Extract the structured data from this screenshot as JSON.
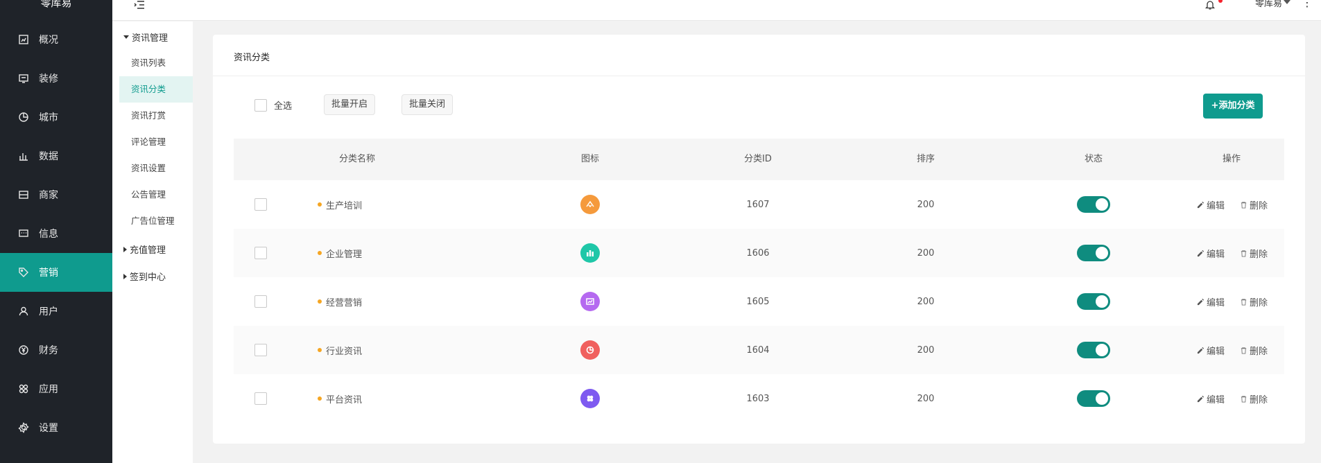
{
  "app": {
    "brand": "零库易"
  },
  "sidebar": {
    "items": [
      {
        "label": "概况",
        "icon": "overview-icon"
      },
      {
        "label": "装修",
        "icon": "decoration-icon"
      },
      {
        "label": "城市",
        "icon": "city-icon"
      },
      {
        "label": "数据",
        "icon": "data-icon"
      },
      {
        "label": "商家",
        "icon": "merchant-icon"
      },
      {
        "label": "信息",
        "icon": "message-icon"
      },
      {
        "label": "营销",
        "icon": "tag-icon",
        "active": true
      },
      {
        "label": "用户",
        "icon": "user-icon"
      },
      {
        "label": "财务",
        "icon": "yen-icon"
      },
      {
        "label": "应用",
        "icon": "apps-icon"
      },
      {
        "label": "设置",
        "icon": "gear-icon"
      }
    ]
  },
  "topbar": {
    "user": "零库易",
    "notification": true
  },
  "subnav": {
    "groups": [
      {
        "label": "资讯管理",
        "expanded": true,
        "items": [
          "资讯列表",
          "资讯分类",
          "资讯打赏",
          "评论管理",
          "资讯设置",
          "公告管理",
          "广告位管理"
        ],
        "active": "资讯分类"
      },
      {
        "label": "充值管理",
        "expanded": false
      },
      {
        "label": "签到中心",
        "expanded": false
      }
    ]
  },
  "page": {
    "title": "资讯分类",
    "select_all": "全选",
    "batch_open": "批量开启",
    "batch_close": "批量关闭",
    "add_button": "+添加分类"
  },
  "table": {
    "columns": [
      "分类名称",
      "图标",
      "分类ID",
      "排序",
      "状态",
      "操作"
    ],
    "rows": [
      {
        "name": "生产培训",
        "icon": "training-icon",
        "icon_color": "#f59a3c",
        "id": "1607",
        "sort": "200",
        "enabled": true
      },
      {
        "name": "企业管理",
        "icon": "chart-bar-icon",
        "icon_color": "#1fc7a8",
        "id": "1606",
        "sort": "200",
        "enabled": true
      },
      {
        "name": "经营营销",
        "icon": "marketing-icon",
        "icon_color": "#b569f0",
        "id": "1605",
        "sort": "200",
        "enabled": true
      },
      {
        "name": "行业资讯",
        "icon": "pie-chart-icon",
        "icon_color": "#f0605e",
        "id": "1604",
        "sort": "200",
        "enabled": true
      },
      {
        "name": "平台资讯",
        "icon": "clover-icon",
        "icon_color": "#7e5af0",
        "id": "1603",
        "sort": "200",
        "enabled": true
      }
    ],
    "actions": {
      "edit": "编辑",
      "delete": "删除"
    }
  },
  "colors": {
    "accent": "#0f9b8e",
    "sidebar_bg": "#1f2329",
    "bullet": "#f5a623"
  }
}
